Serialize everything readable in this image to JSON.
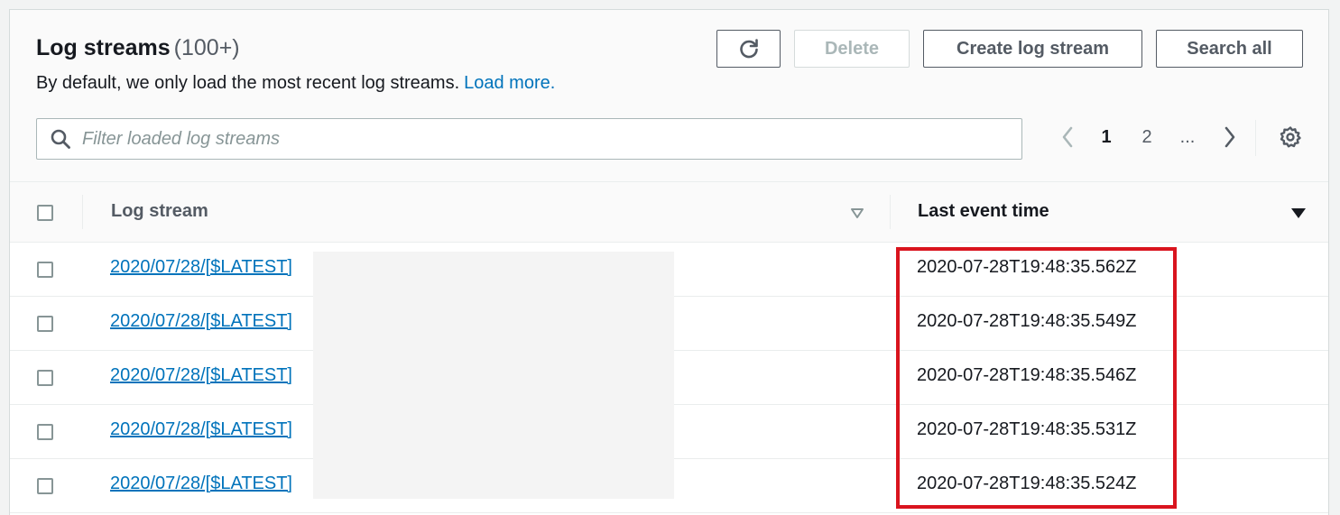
{
  "header": {
    "title": "Log streams",
    "count": "(100+)",
    "description": "By default, we only load the most recent log streams.",
    "load_more": "Load more."
  },
  "toolbar": {
    "refresh_icon": "refresh-icon",
    "delete_label": "Delete",
    "create_label": "Create log stream",
    "search_all_label": "Search all"
  },
  "filter": {
    "placeholder": "Filter loaded log streams",
    "value": ""
  },
  "pagination": {
    "pages": [
      "1",
      "2"
    ],
    "ellipsis": "...",
    "current": "1"
  },
  "table": {
    "columns": {
      "log_stream": "Log stream",
      "last_event_time": "Last event time"
    },
    "rows": [
      {
        "stream": "2020/07/28/[$LATEST]",
        "time": "2020-07-28T19:48:35.562Z"
      },
      {
        "stream": "2020/07/28/[$LATEST]",
        "time": "2020-07-28T19:48:35.549Z"
      },
      {
        "stream": "2020/07/28/[$LATEST]",
        "time": "2020-07-28T19:48:35.546Z"
      },
      {
        "stream": "2020/07/28/[$LATEST]",
        "time": "2020-07-28T19:48:35.531Z"
      },
      {
        "stream": "2020/07/28/[$LATEST]",
        "time": "2020-07-28T19:48:35.524Z"
      }
    ]
  },
  "colors": {
    "link": "#0073bb",
    "highlight": "#d9141e",
    "text": "#16191f",
    "muted": "#545b64"
  }
}
